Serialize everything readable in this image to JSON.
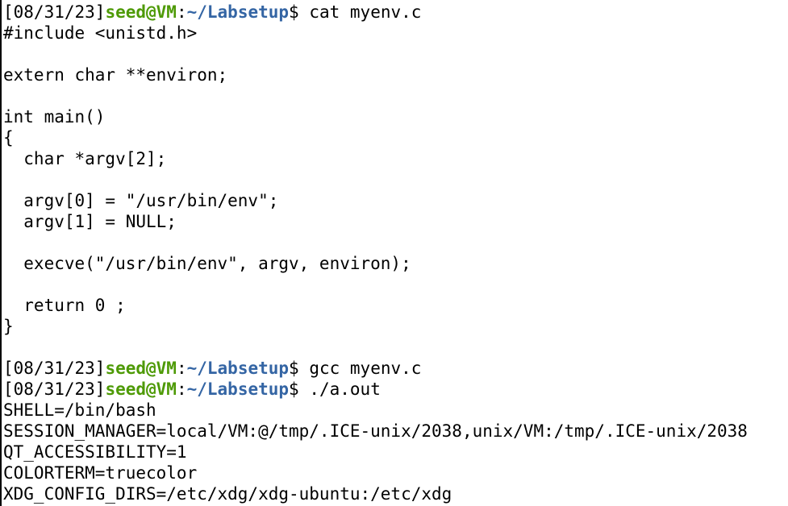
{
  "colors": {
    "user": "#4e9a06",
    "path": "#3465a4",
    "text": "#000000",
    "background": "#ffffff"
  },
  "lines": [
    {
      "type": "prompt",
      "timestamp": "[08/31/23]",
      "user": "seed@VM",
      "sep": ":",
      "path": "~/Labsetup",
      "dollar": "$ ",
      "command": "cat myenv.c"
    },
    {
      "type": "output",
      "text": "#include <unistd.h>"
    },
    {
      "type": "output",
      "text": ""
    },
    {
      "type": "output",
      "text": "extern char **environ;"
    },
    {
      "type": "output",
      "text": ""
    },
    {
      "type": "output",
      "text": "int main()"
    },
    {
      "type": "output",
      "text": "{"
    },
    {
      "type": "output",
      "text": "  char *argv[2];"
    },
    {
      "type": "output",
      "text": ""
    },
    {
      "type": "output",
      "text": "  argv[0] = \"/usr/bin/env\";"
    },
    {
      "type": "output",
      "text": "  argv[1] = NULL;"
    },
    {
      "type": "output",
      "text": ""
    },
    {
      "type": "output",
      "text": "  execve(\"/usr/bin/env\", argv, environ);"
    },
    {
      "type": "output",
      "text": ""
    },
    {
      "type": "output",
      "text": "  return 0 ;"
    },
    {
      "type": "output",
      "text": "}"
    },
    {
      "type": "output",
      "text": ""
    },
    {
      "type": "prompt",
      "timestamp": "[08/31/23]",
      "user": "seed@VM",
      "sep": ":",
      "path": "~/Labsetup",
      "dollar": "$ ",
      "command": "gcc myenv.c"
    },
    {
      "type": "prompt",
      "timestamp": "[08/31/23]",
      "user": "seed@VM",
      "sep": ":",
      "path": "~/Labsetup",
      "dollar": "$ ",
      "command": "./a.out"
    },
    {
      "type": "output",
      "text": "SHELL=/bin/bash"
    },
    {
      "type": "output",
      "text": "SESSION_MANAGER=local/VM:@/tmp/.ICE-unix/2038,unix/VM:/tmp/.ICE-unix/2038"
    },
    {
      "type": "output",
      "text": "QT_ACCESSIBILITY=1"
    },
    {
      "type": "output",
      "text": "COLORTERM=truecolor"
    },
    {
      "type": "output",
      "text": "XDG_CONFIG_DIRS=/etc/xdg/xdg-ubuntu:/etc/xdg"
    }
  ]
}
